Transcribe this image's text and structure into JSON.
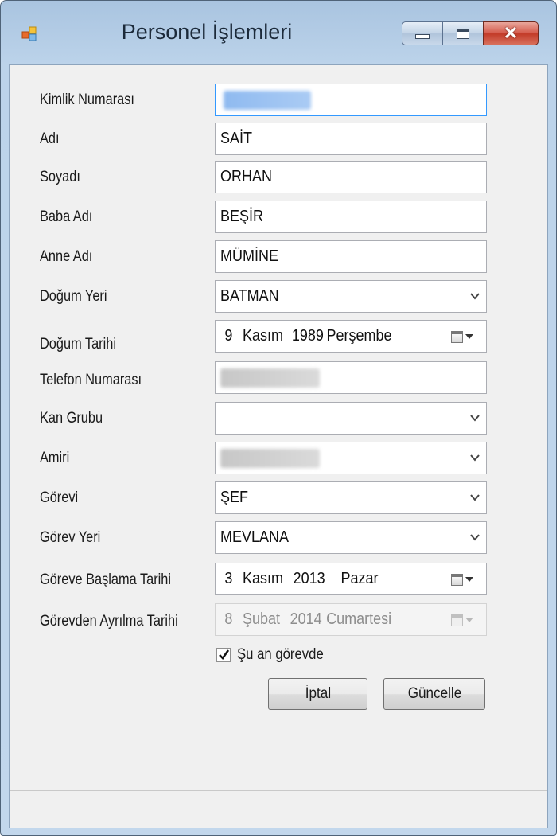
{
  "window": {
    "title": "Personel İşlemleri"
  },
  "form": {
    "kimlik_label": "Kimlik Numarası",
    "adi_label": "Adı",
    "adi_value": "SAİT",
    "soyadi_label": "Soyadı",
    "soyadi_value": "ORHAN",
    "baba_label": "Baba Adı",
    "baba_value": "BEŞİR",
    "anne_label": "Anne Adı",
    "anne_value": "MÜMİNE",
    "dogum_yeri_label": "Doğum Yeri",
    "dogum_yeri_value": "BATMAN",
    "dogum_tarihi_label": "Doğum Tarihi",
    "dogum_tarihi": {
      "day": "9",
      "month": "Kasım",
      "year": "1989",
      "weekday": "Perşembe"
    },
    "telefon_label": "Telefon Numarası",
    "kan_grubu_label": "Kan Grubu",
    "kan_grubu_value": "",
    "amiri_label": "Amiri",
    "gorevi_label": "Görevi",
    "gorevi_value": "ŞEF",
    "gorev_yeri_label": "Görev Yeri",
    "gorev_yeri_value": "MEVLANA",
    "baslama_label": "Göreve Başlama Tarihi",
    "baslama_tarihi": {
      "day": "3",
      "month": "Kasım",
      "year": "2013",
      "weekday": "Pazar"
    },
    "ayrilma_label": "Görevden Ayrılma Tarihi",
    "ayrilma_tarihi": {
      "day": "8",
      "month": "Şubat",
      "year": "2014",
      "weekday": "Cumartesi"
    },
    "su_an_gorevde_label": "Şu an görevde",
    "su_an_gorevde_checked": true
  },
  "buttons": {
    "iptal": "İptal",
    "guncelle": "Güncelle"
  }
}
